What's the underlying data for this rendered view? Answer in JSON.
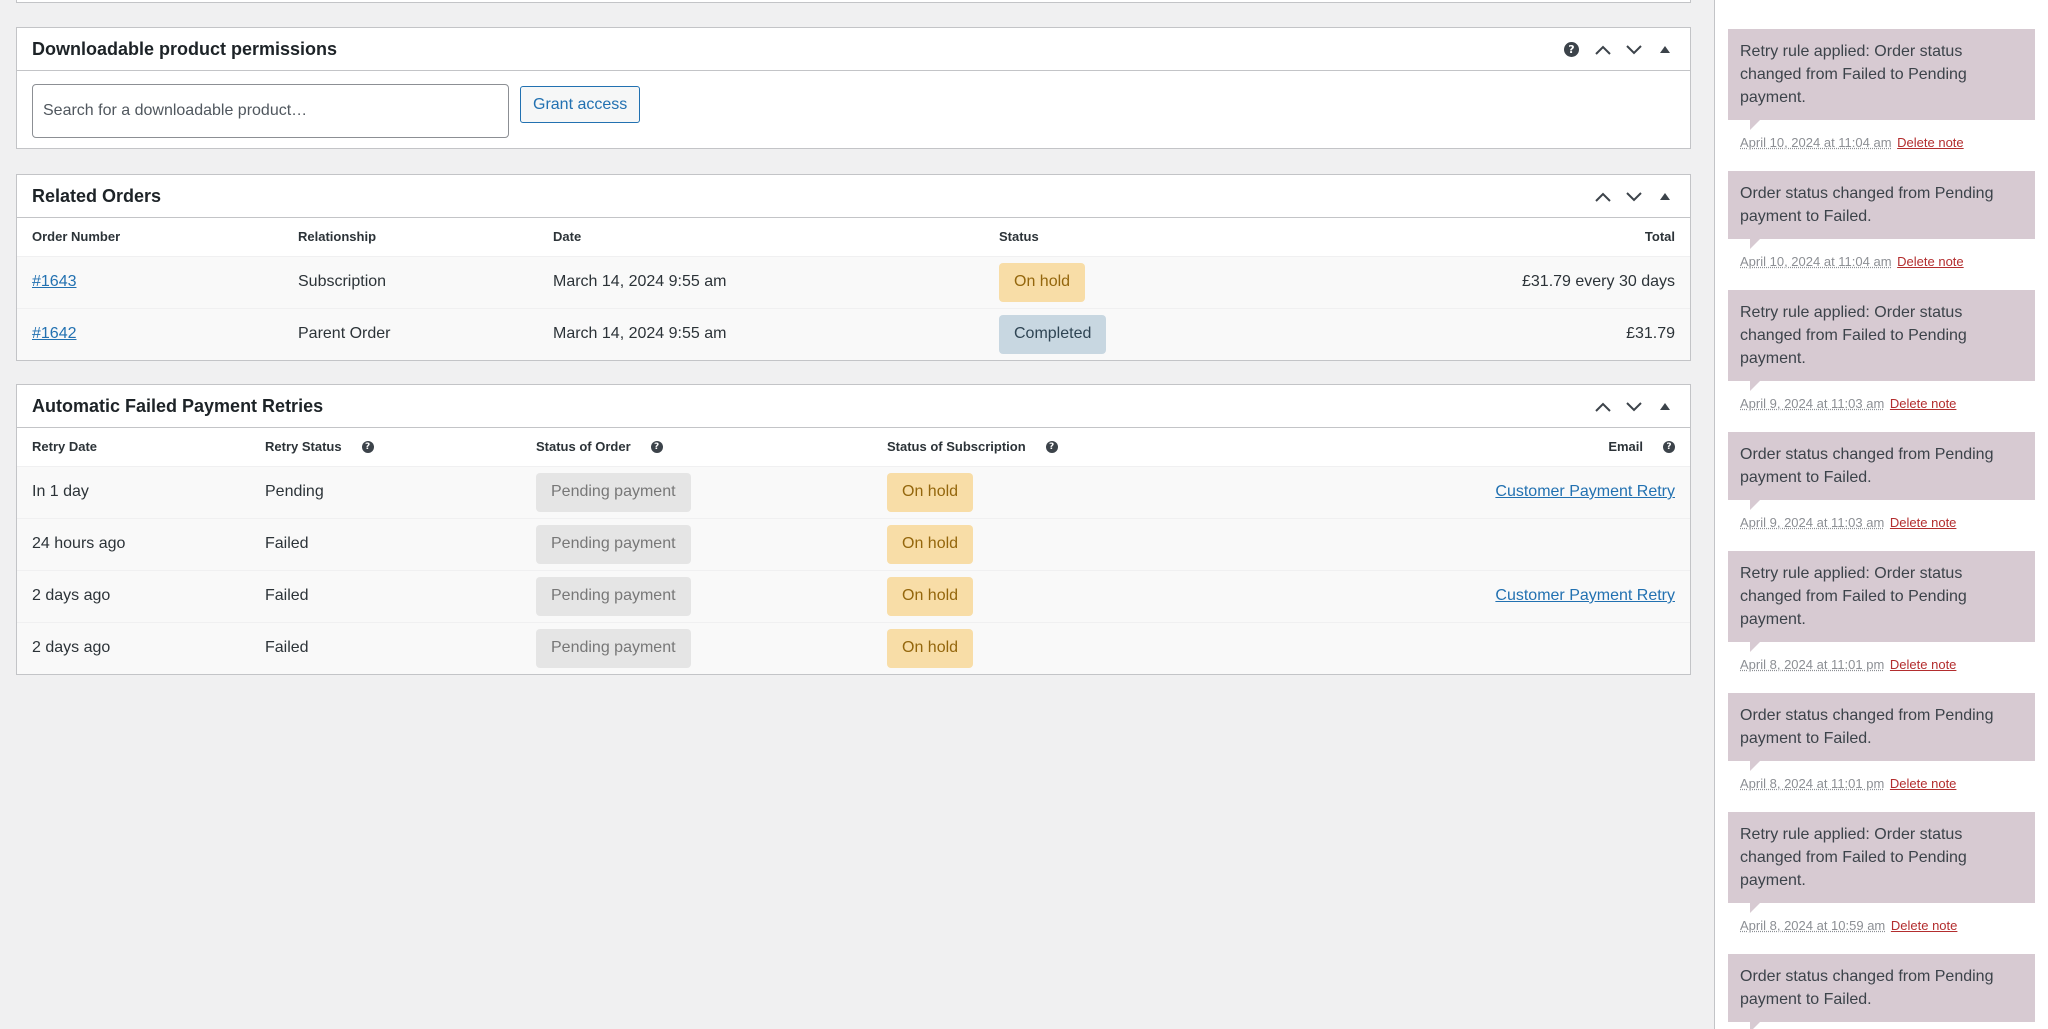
{
  "downloadable": {
    "title": "Downloadable product permissions",
    "search_placeholder": "Search for a downloadable product…",
    "grant_label": "Grant access"
  },
  "related_orders": {
    "title": "Related Orders",
    "columns": [
      "Order Number",
      "Relationship",
      "Date",
      "Status",
      "Total"
    ],
    "rows": [
      {
        "number": "#1643",
        "relationship": "Subscription",
        "date": "March 14, 2024 9:55 am",
        "status": "On hold",
        "total": "£31.79 every 30 days"
      },
      {
        "number": "#1642",
        "relationship": "Parent Order",
        "date": "March 14, 2024 9:55 am",
        "status": "Completed",
        "total": "£31.79"
      }
    ]
  },
  "retries": {
    "title": "Automatic Failed Payment Retries",
    "columns": [
      "Retry Date",
      "Retry Status",
      "Status of Order",
      "Status of Subscription",
      "Email"
    ],
    "rows": [
      {
        "date": "In 1 day",
        "status": "Pending",
        "order_status": "Pending payment",
        "sub_status": "On hold",
        "email": "Customer Payment Retry"
      },
      {
        "date": "24 hours ago",
        "status": "Failed",
        "order_status": "Pending payment",
        "sub_status": "On hold",
        "email": ""
      },
      {
        "date": "2 days ago",
        "status": "Failed",
        "order_status": "Pending payment",
        "sub_status": "On hold",
        "email": "Customer Payment Retry"
      },
      {
        "date": "2 days ago",
        "status": "Failed",
        "order_status": "Pending payment",
        "sub_status": "On hold",
        "email": ""
      }
    ]
  },
  "notes": {
    "delete_label": "Delete note",
    "items": [
      {
        "text": "Retry rule applied: Order status changed from Failed to Pending payment.",
        "date": "April 10, 2024 at 11:04 am"
      },
      {
        "text": "Order status changed from Pending payment to Failed.",
        "date": "April 10, 2024 at 11:04 am"
      },
      {
        "text": "Retry rule applied: Order status changed from Failed to Pending payment.",
        "date": "April 9, 2024 at 11:03 am"
      },
      {
        "text": "Order status changed from Pending payment to Failed.",
        "date": "April 9, 2024 at 11:03 am"
      },
      {
        "text": "Retry rule applied: Order status changed from Failed to Pending payment.",
        "date": "April 8, 2024 at 11:01 pm"
      },
      {
        "text": "Order status changed from Pending payment to Failed.",
        "date": "April 8, 2024 at 11:01 pm"
      },
      {
        "text": "Retry rule applied: Order status changed from Failed to Pending payment.",
        "date": "April 8, 2024 at 10:59 am"
      },
      {
        "text": "Order status changed from Pending payment to Failed.",
        "date": ""
      }
    ]
  },
  "colors": {
    "link": "#2271b1",
    "on_hold_bg": "#f8dda7",
    "completed_bg": "#c8d7e1",
    "pending_bg": "#e5e5e5",
    "note_bg": "#d7cad2",
    "delete": "#b32d2e"
  },
  "icons": [
    "help-icon",
    "move-up-icon",
    "move-down-icon",
    "toggle-panel-icon"
  ]
}
